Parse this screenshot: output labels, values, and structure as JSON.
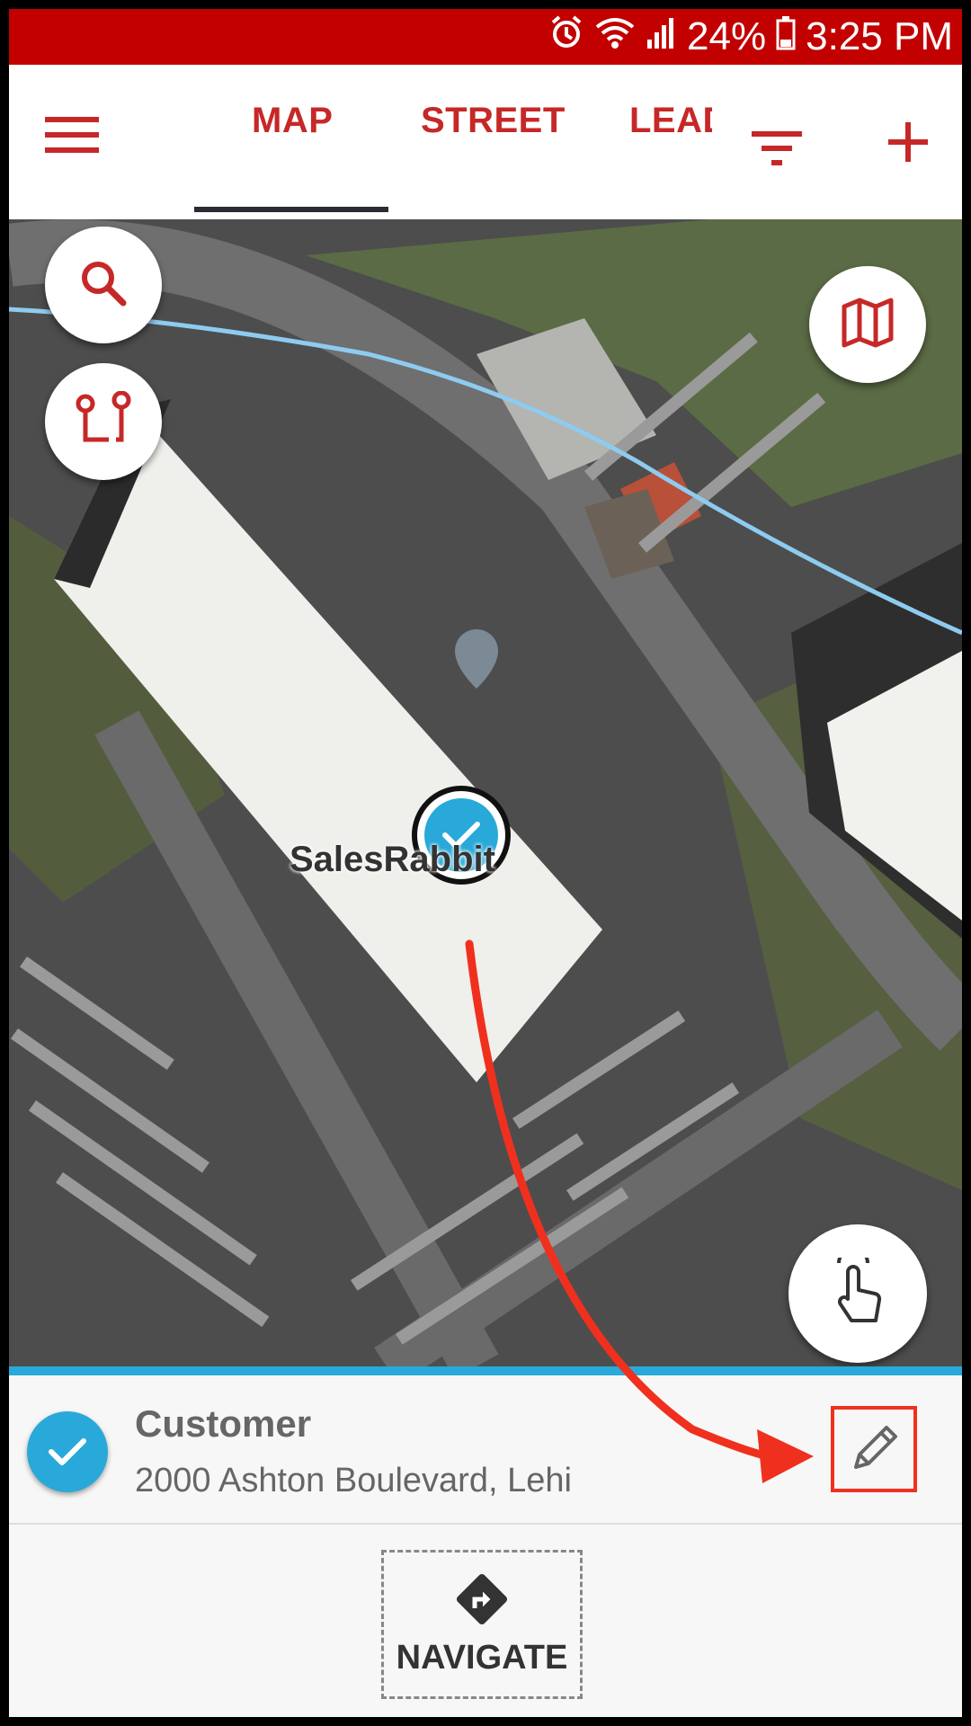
{
  "status_bar": {
    "battery": "24%",
    "time": "3:25 PM",
    "icons": [
      "alarm-icon",
      "wifi-icon",
      "signal-icon",
      "battery-icon"
    ]
  },
  "toolbar": {
    "tabs": [
      "MAP",
      "STREET",
      "LEADS"
    ],
    "active_tab": "MAP",
    "icons": [
      "menu-icon",
      "filter-icon",
      "add-icon"
    ]
  },
  "map": {
    "place_label": "SalesRabbit",
    "buttons": [
      "search-icon",
      "route-icon",
      "map-layers-icon",
      "touch-select-icon"
    ]
  },
  "details": {
    "title": "Customer",
    "address": "2000 Ashton Boulevard, Lehi",
    "navigate_label": "NAVIGATE"
  },
  "colors": {
    "brand": "#c20000",
    "accent": "#29a9d9",
    "annotation": "#f0301e"
  }
}
